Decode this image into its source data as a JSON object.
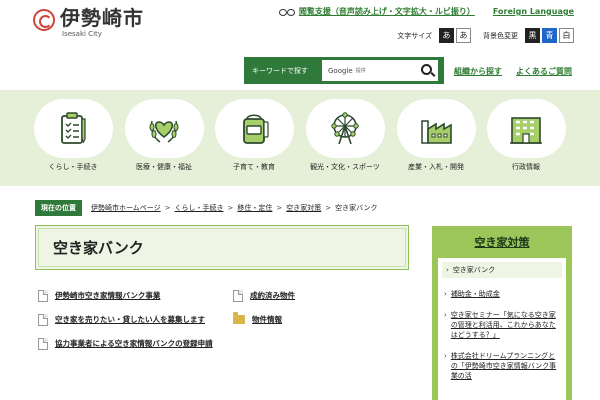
{
  "header": {
    "logo_name": "伊勢崎市",
    "logo_sub": "Isesaki City",
    "util_reading_support": "閲覧支援（音声読み上げ・文字拡大・ルビ振り）",
    "util_foreign": "Foreign Language",
    "font_size_label": "文字サイズ",
    "font_btn_dark": "あ",
    "font_btn_light": "あ",
    "bg_color_label": "背景色変更",
    "bg_btn_black": "黒",
    "bg_btn_blue": "青",
    "bg_btn_white": "白",
    "search_label": "キーワードで探す",
    "search_google": "Google",
    "search_provided": "提供",
    "link_org": "組織から探す",
    "link_faq": "よくあるご質問"
  },
  "categories": [
    {
      "label": "くらし・手続き"
    },
    {
      "label": "医療・健康・福祉"
    },
    {
      "label": "子育て・教育"
    },
    {
      "label": "観光・文化・スポーツ"
    },
    {
      "label": "産業・入札・開発"
    },
    {
      "label": "行政情報"
    }
  ],
  "breadcrumb": {
    "current_label": "現在の位置",
    "items": [
      "伊勢崎市ホームページ",
      "くらし・手続き",
      "移住・定住",
      "空き家対策"
    ],
    "separator": ">",
    "last": "空き家バンク"
  },
  "main": {
    "title": "空き家バンク",
    "left_list": [
      {
        "text": "伊勢崎市空き家情報バンク事業"
      },
      {
        "text": "空き家を売りたい・貸したい人を募集します"
      },
      {
        "text": "協力事業者による空き家情報バンクの登録申請"
      }
    ],
    "right_list": [
      {
        "text": "成約済み物件"
      },
      {
        "text": "物件情報"
      }
    ]
  },
  "sidebar": {
    "title": "空き家対策",
    "items": [
      {
        "text": "空き家バンク",
        "active": true
      },
      {
        "text": "補助金・助成金"
      },
      {
        "text": "空き家セミナー「気になる空き家の管理と利活用、これからあなたはどうする？」"
      },
      {
        "text": "株式会社ドリームプランニングとの「伊勢崎市空き家情報バンク事業の活"
      }
    ]
  },
  "colors": {
    "brand_green": "#2f7a3a",
    "band_bg": "#e6f0d8",
    "sidebar_green": "#9cc55a",
    "logo_red": "#d0443a"
  }
}
